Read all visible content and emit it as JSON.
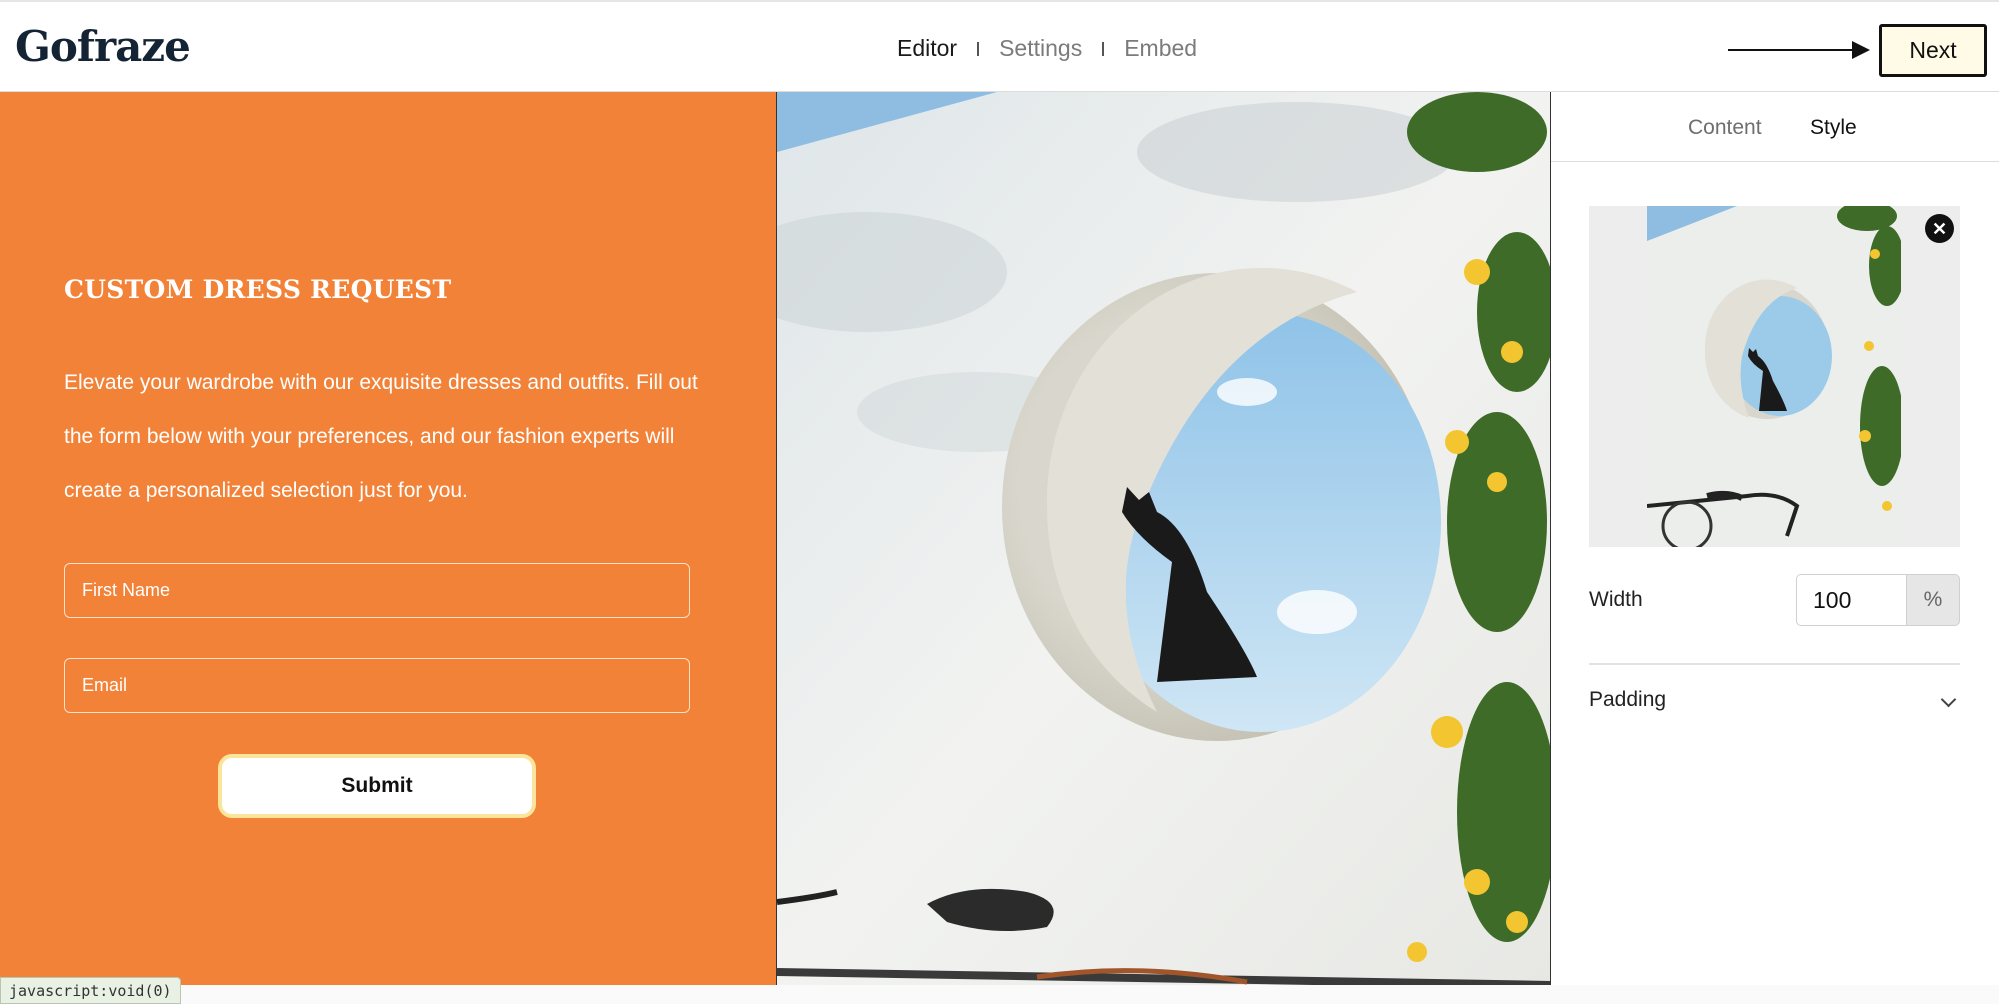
{
  "header": {
    "logo": "Gofraze",
    "nav": [
      {
        "label": "Editor",
        "active": true
      },
      {
        "label": "Settings",
        "active": false
      },
      {
        "label": "Embed",
        "active": false
      }
    ],
    "next_label": "Next"
  },
  "form": {
    "title": "CUSTOM DRESS REQUEST",
    "description": "Elevate your wardrobe with our exquisite dresses and outfits. Fill out the form below with your preferences, and our fashion experts will create a personalized selection just for you.",
    "fields": [
      {
        "placeholder": "First Name"
      },
      {
        "placeholder": "Email"
      }
    ],
    "submit_label": "Submit",
    "background_color": "#f28238"
  },
  "style_panel": {
    "tabs": [
      {
        "label": "Content",
        "active": false
      },
      {
        "label": "Style",
        "active": true
      }
    ],
    "width_label": "Width",
    "width_value": "100",
    "width_unit": "%",
    "padding_label": "Padding"
  },
  "icons": {
    "close": "close-icon",
    "chevron": "chevron-down-icon",
    "arrow": "arrow-right-icon"
  },
  "status_bar": "javascript:void(0)"
}
